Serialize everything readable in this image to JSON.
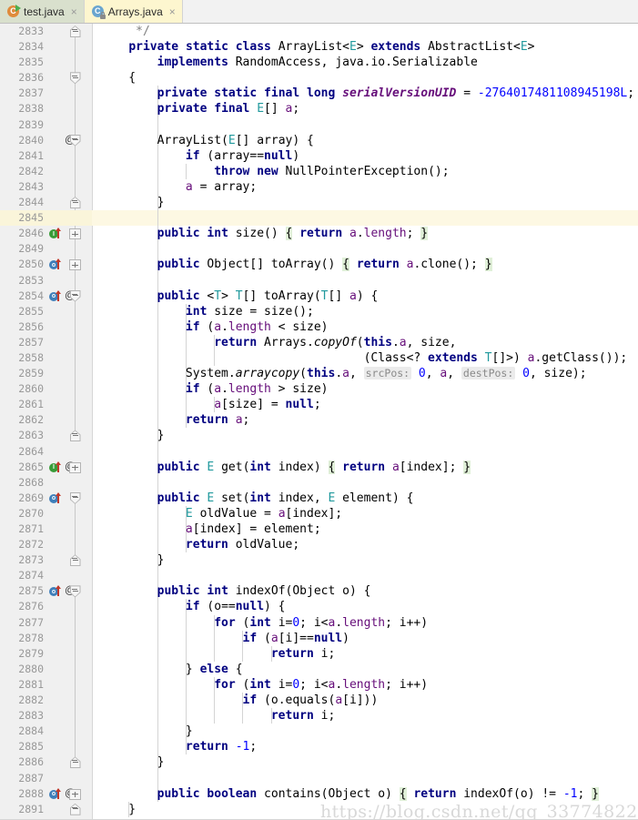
{
  "window": {
    "app": "IntelliJ IDEA Editor",
    "tabs": [
      {
        "label": "test.java",
        "icon": "java-class-runnable-icon",
        "close": "×",
        "active": false,
        "badge": "C"
      },
      {
        "label": "Arrays.java",
        "icon": "java-class-readonly-icon",
        "close": "×",
        "active": true,
        "badge": "C"
      }
    ]
  },
  "editor": {
    "file": "Arrays.java",
    "language": "Java",
    "current_line": 2845,
    "first_line_number": 2833,
    "last_line_number": 2891,
    "watermark": "https://blog.csdn.net/qq_33774822",
    "line_numbers": [
      "2833",
      "2834",
      "2835",
      "2836",
      "2837",
      "2838",
      "2839",
      "2840",
      "2841",
      "2842",
      "2843",
      "2844",
      "2845",
      "2846",
      "2849",
      "2850",
      "2853",
      "2854",
      "2855",
      "2856",
      "2857",
      "2858",
      "2859",
      "2860",
      "2861",
      "2862",
      "2863",
      "2864",
      "2865",
      "2868",
      "2869",
      "2870",
      "2871",
      "2872",
      "2873",
      "2874",
      "2875",
      "2876",
      "2877",
      "2878",
      "2879",
      "2880",
      "2881",
      "2882",
      "2883",
      "2884",
      "2885",
      "2886",
      "2887",
      "2888",
      "2891"
    ],
    "source_lines": [
      "     */",
      "    private static class ArrayList<E> extends AbstractList<E>",
      "        implements RandomAccess, java.io.Serializable",
      "    {",
      "        private static final long serialVersionUID = -2764017481108945198L;",
      "        private final E[] a;",
      "",
      "        ArrayList(E[] array) {",
      "            if (array==null)",
      "                throw new NullPointerException();",
      "            a = array;",
      "        }",
      "",
      "        public int size() { return a.length; }",
      "",
      "        public Object[] toArray() { return a.clone(); }",
      "",
      "        public <T> T[] toArray(T[] a) {",
      "            int size = size();",
      "            if (a.length < size)",
      "                return Arrays.copyOf(this.a, size,",
      "                                     (Class<? extends T[]>) a.getClass());",
      "            System.arraycopy(this.a, srcPos: 0, a, destPos: 0, size);",
      "            if (a.length > size)",
      "                a[size] = null;",
      "            return a;",
      "        }",
      "",
      "        public E get(int index) { return a[index]; }",
      "",
      "        public E set(int index, E element) {",
      "            E oldValue = a[index];",
      "            a[index] = element;",
      "            return oldValue;",
      "        }",
      "",
      "        public int indexOf(Object o) {",
      "            if (o==null) {",
      "                for (int i=0; i<a.length; i++)",
      "                    if (a[i]==null)",
      "                        return i;",
      "            } else {",
      "                for (int i=0; i<a.length; i++)",
      "                    if (o.equals(a[i]))",
      "                        return i;",
      "            }",
      "            return -1;",
      "        }",
      "",
      "        public boolean contains(Object o) { return indexOf(o) != -1; }",
      "    }"
    ],
    "inlay_hints": [
      {
        "line": 2859,
        "label": "srcPos:",
        "value": "0"
      },
      {
        "line": 2859,
        "label": "destPos:",
        "value": "0"
      }
    ],
    "gutter_markers": [
      {
        "line": 2840,
        "type": "annotation",
        "glyph": "@"
      },
      {
        "line": 2846,
        "type": "implementing-method-icon",
        "glyph": "I"
      },
      {
        "line": 2850,
        "type": "overriding-method-icon",
        "glyph": "o"
      },
      {
        "line": 2854,
        "type": "overriding-method-icon",
        "glyph": "o",
        "annotation": "@"
      },
      {
        "line": 2865,
        "type": "implementing-method-icon",
        "glyph": "I",
        "annotation": "@"
      },
      {
        "line": 2869,
        "type": "overriding-method-icon",
        "glyph": "o"
      },
      {
        "line": 2875,
        "type": "overriding-method-icon",
        "glyph": "o",
        "annotation": "@"
      },
      {
        "line": 2888,
        "type": "overriding-method-icon",
        "glyph": "o",
        "annotation": "@"
      }
    ],
    "colors": {
      "background": "#ffffff",
      "gutter": "#f0f0f0",
      "current_line_highlight": "#fdf8e3",
      "keyword": "#000080",
      "comment": "#808080",
      "number": "#0000ff",
      "field": "#660e7a",
      "type_param": "#20999d",
      "brace_match": "#e0f0d8",
      "line_number": "#999999",
      "active_tab": "#fdf6cf",
      "inactive_tab": "#d9e0cd"
    }
  }
}
